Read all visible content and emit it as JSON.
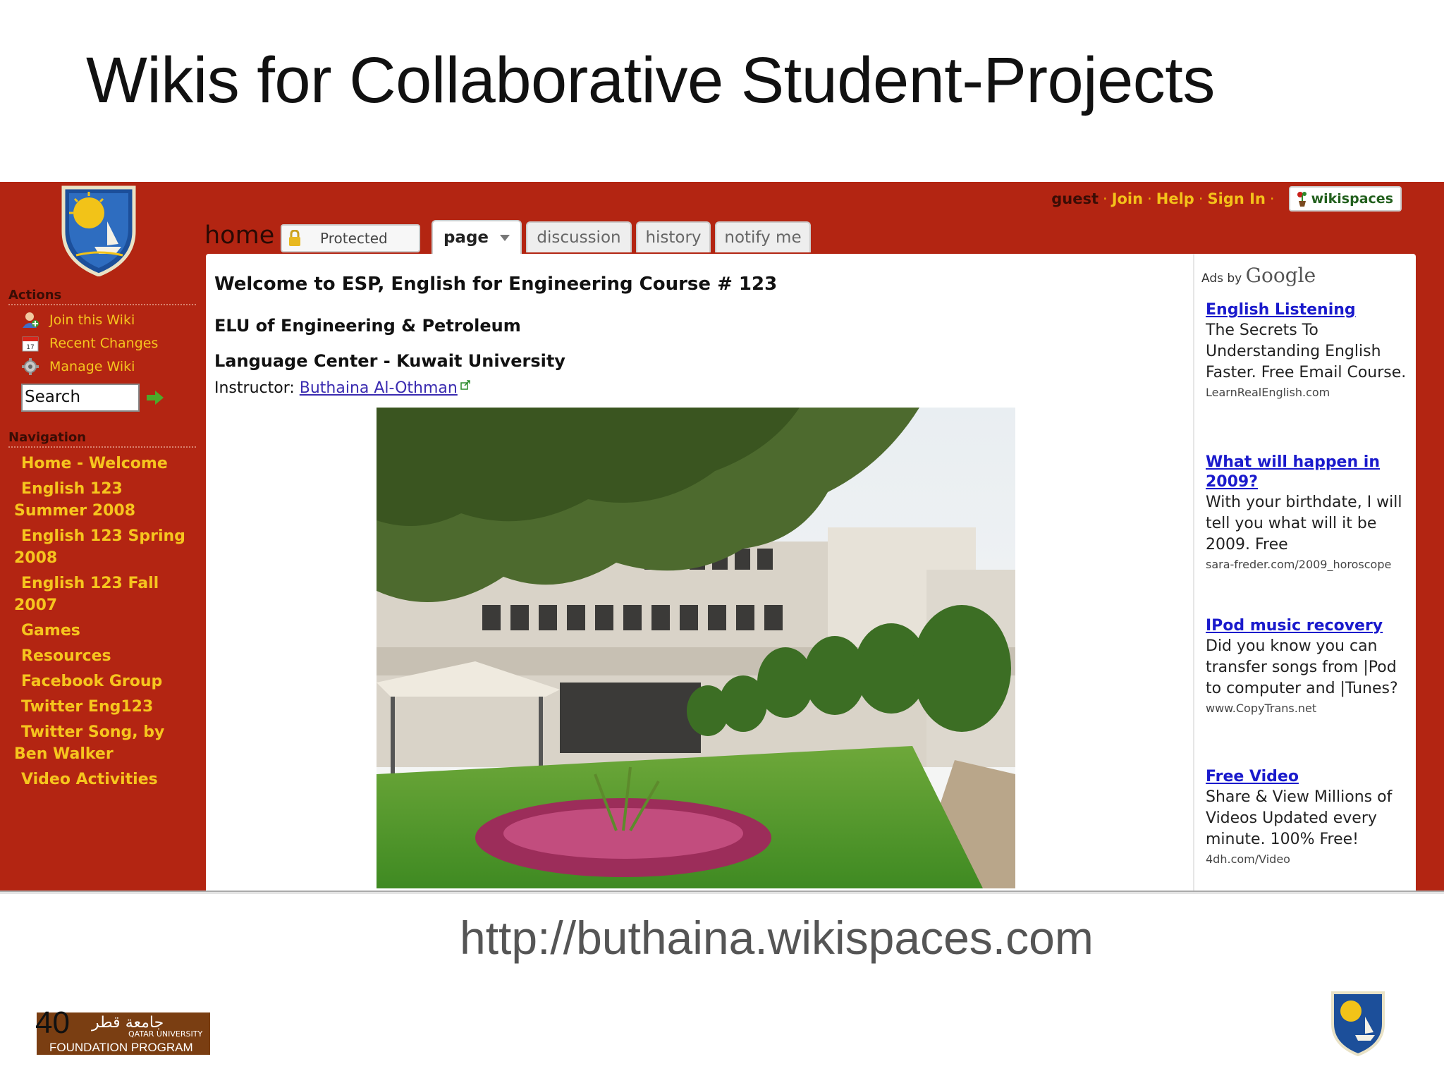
{
  "slide": {
    "title": "Wikis for Collaborative Student-Projects",
    "url": "http://buthaina.wikispaces.com",
    "number": "40",
    "footer_logo": {
      "arabic": "جامعة قطر",
      "english": "QATAR UNIVERSITY",
      "program": "FOUNDATION PROGRAM"
    }
  },
  "userbar": {
    "guest": "guest",
    "join": "Join",
    "help": "Help",
    "sign_in": "Sign In",
    "brand": "wikispaces"
  },
  "tabs": {
    "home": "home",
    "protected": "Protected",
    "page": "page",
    "discussion": "discussion",
    "history": "history",
    "notify": "notify me"
  },
  "sidebar": {
    "actions_heading": "Actions",
    "actions": [
      {
        "label": "Join this Wiki",
        "icon": "join-user-icon"
      },
      {
        "label": "Recent Changes",
        "icon": "calendar-icon"
      },
      {
        "label": "Manage Wiki",
        "icon": "gear-icon"
      }
    ],
    "search_value": "Search",
    "navigation_heading": "Navigation",
    "nav": [
      "Home - Welcome",
      "English 123 Summer 2008",
      "English 123 Spring 2008",
      "English 123 Fall 2007",
      "Games",
      "Resources",
      "Facebook Group",
      "Twitter Eng123",
      "Twitter Song, by Ben Walker",
      "Video Activities"
    ]
  },
  "content": {
    "welcome": "Welcome to ESP, English for Engineering Course # 123",
    "elu": "ELU of Engineering & Petroleum",
    "center": "Language Center - Kuwait University",
    "instructor_label": "Instructor: ",
    "instructor_name": "Buthaina Al-Othman"
  },
  "ads": {
    "ads_by": "Ads by",
    "google": "Google",
    "items": [
      {
        "title": "English Listening",
        "body": "The Secrets To Understanding English Faster. Free Email Course.",
        "url": "LearnRealEnglish.com"
      },
      {
        "title": "What will happen in 2009?",
        "body": "With your birthdate, I will tell you what will it be 2009. Free",
        "url": "sara-freder.com/2009_horoscope"
      },
      {
        "title": "IPod music recovery",
        "body": "Did you know you can transfer songs from |Pod to computer and |Tunes?",
        "url": "www.CopyTrans.net"
      },
      {
        "title": "Free Video",
        "body": "Share & View Millions of Videos Updated every minute. 100% Free!",
        "url": "4dh.com/Video"
      }
    ]
  },
  "colors": {
    "wiki_red": "#b32512",
    "link_yellow": "#f6c51e",
    "ad_link_blue": "#1a1acc"
  }
}
